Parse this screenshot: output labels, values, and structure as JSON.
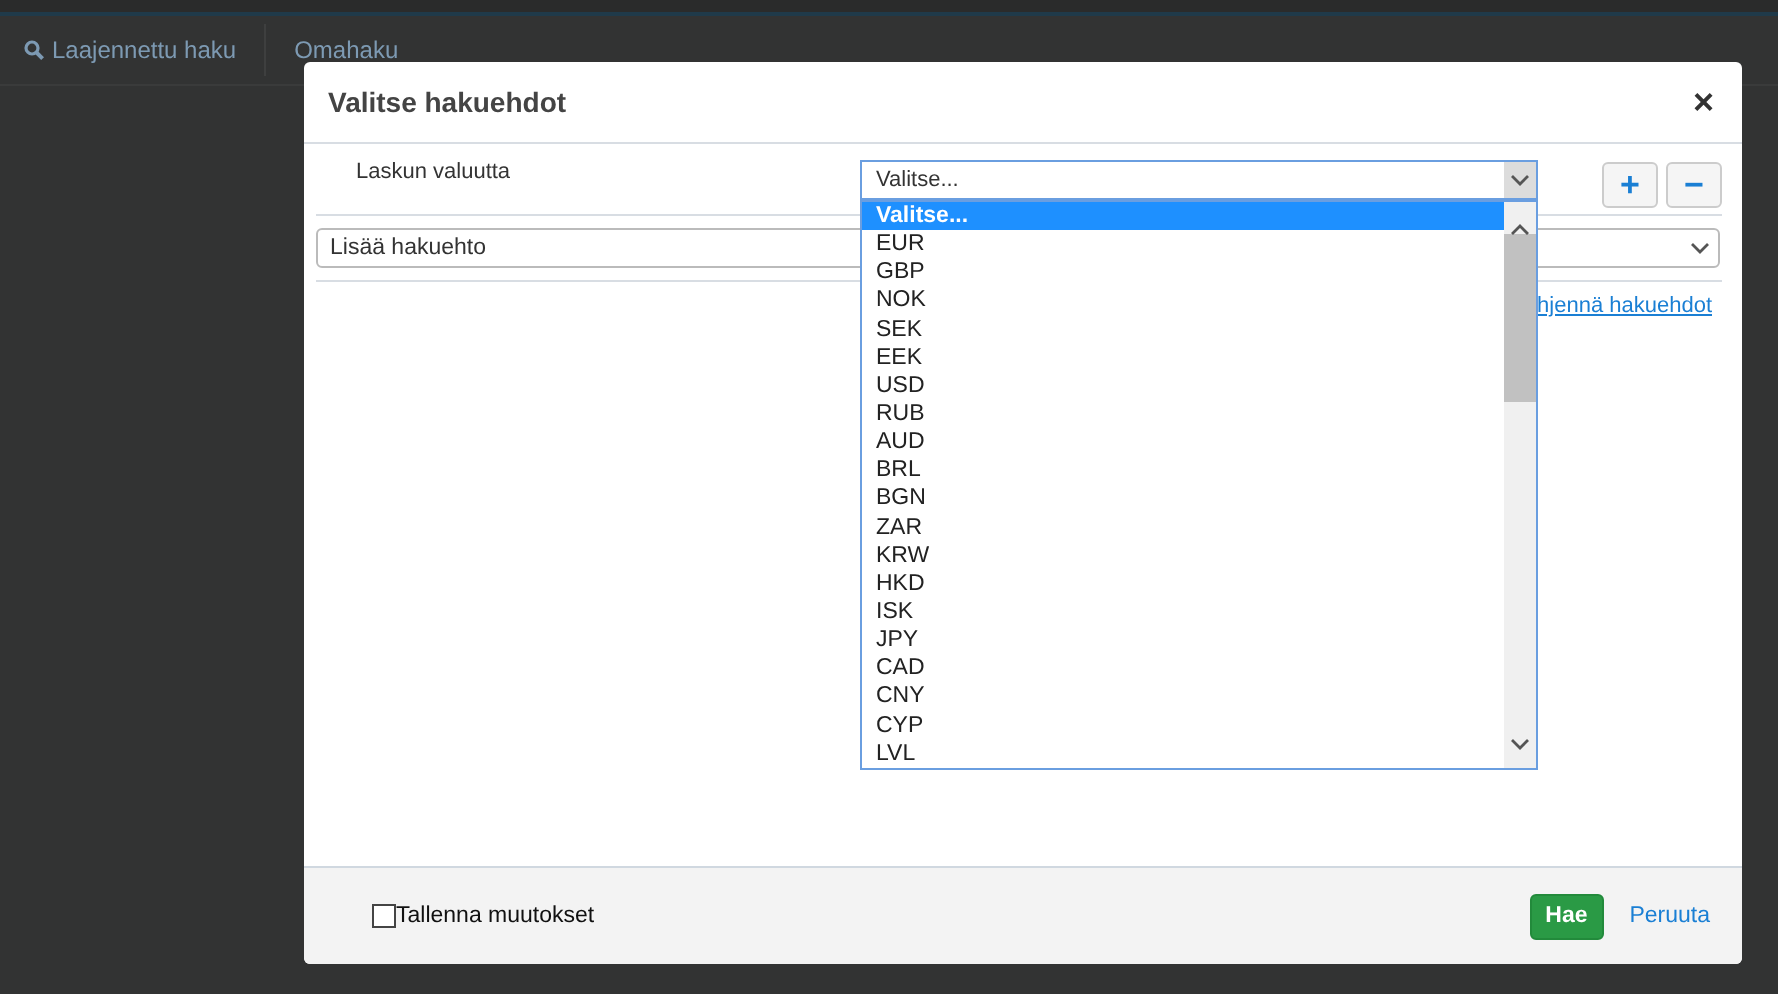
{
  "nav": {
    "items": [
      {
        "label": "Laajennettu haku",
        "kind": "search"
      },
      {
        "label": "Omahaku",
        "kind": "plain"
      }
    ]
  },
  "dialog": {
    "title": "Valitse hakuehdot",
    "close": "×",
    "condition": {
      "label": "Laskun valuutta",
      "value": "Valitse...",
      "expanded": true,
      "add": "+",
      "remove": "−",
      "options": [
        {
          "label": "Valitse...",
          "selected": true
        },
        {
          "label": "EUR",
          "selected": false
        },
        {
          "label": "GBP",
          "selected": false
        },
        {
          "label": "NOK",
          "selected": false
        },
        {
          "label": "SEK",
          "selected": false
        },
        {
          "label": "EEK",
          "selected": false
        },
        {
          "label": "USD",
          "selected": false
        },
        {
          "label": "RUB",
          "selected": false
        },
        {
          "label": "AUD",
          "selected": false
        },
        {
          "label": "BRL",
          "selected": false
        },
        {
          "label": "BGN",
          "selected": false
        },
        {
          "label": "ZAR",
          "selected": false
        },
        {
          "label": "KRW",
          "selected": false
        },
        {
          "label": "HKD",
          "selected": false
        },
        {
          "label": "ISK",
          "selected": false
        },
        {
          "label": "JPY",
          "selected": false
        },
        {
          "label": "CAD",
          "selected": false
        },
        {
          "label": "CNY",
          "selected": false
        },
        {
          "label": "CYP",
          "selected": false
        },
        {
          "label": "LVL",
          "selected": false
        }
      ]
    },
    "add_condition": {
      "value": "Lisää hakuehto"
    },
    "clear_link": "hjennä hakuehdot",
    "footer": {
      "save": {
        "label": "Tallenna muutokset",
        "checked": false
      },
      "search_button": "Hae",
      "cancel_link": "Peruuta"
    }
  }
}
